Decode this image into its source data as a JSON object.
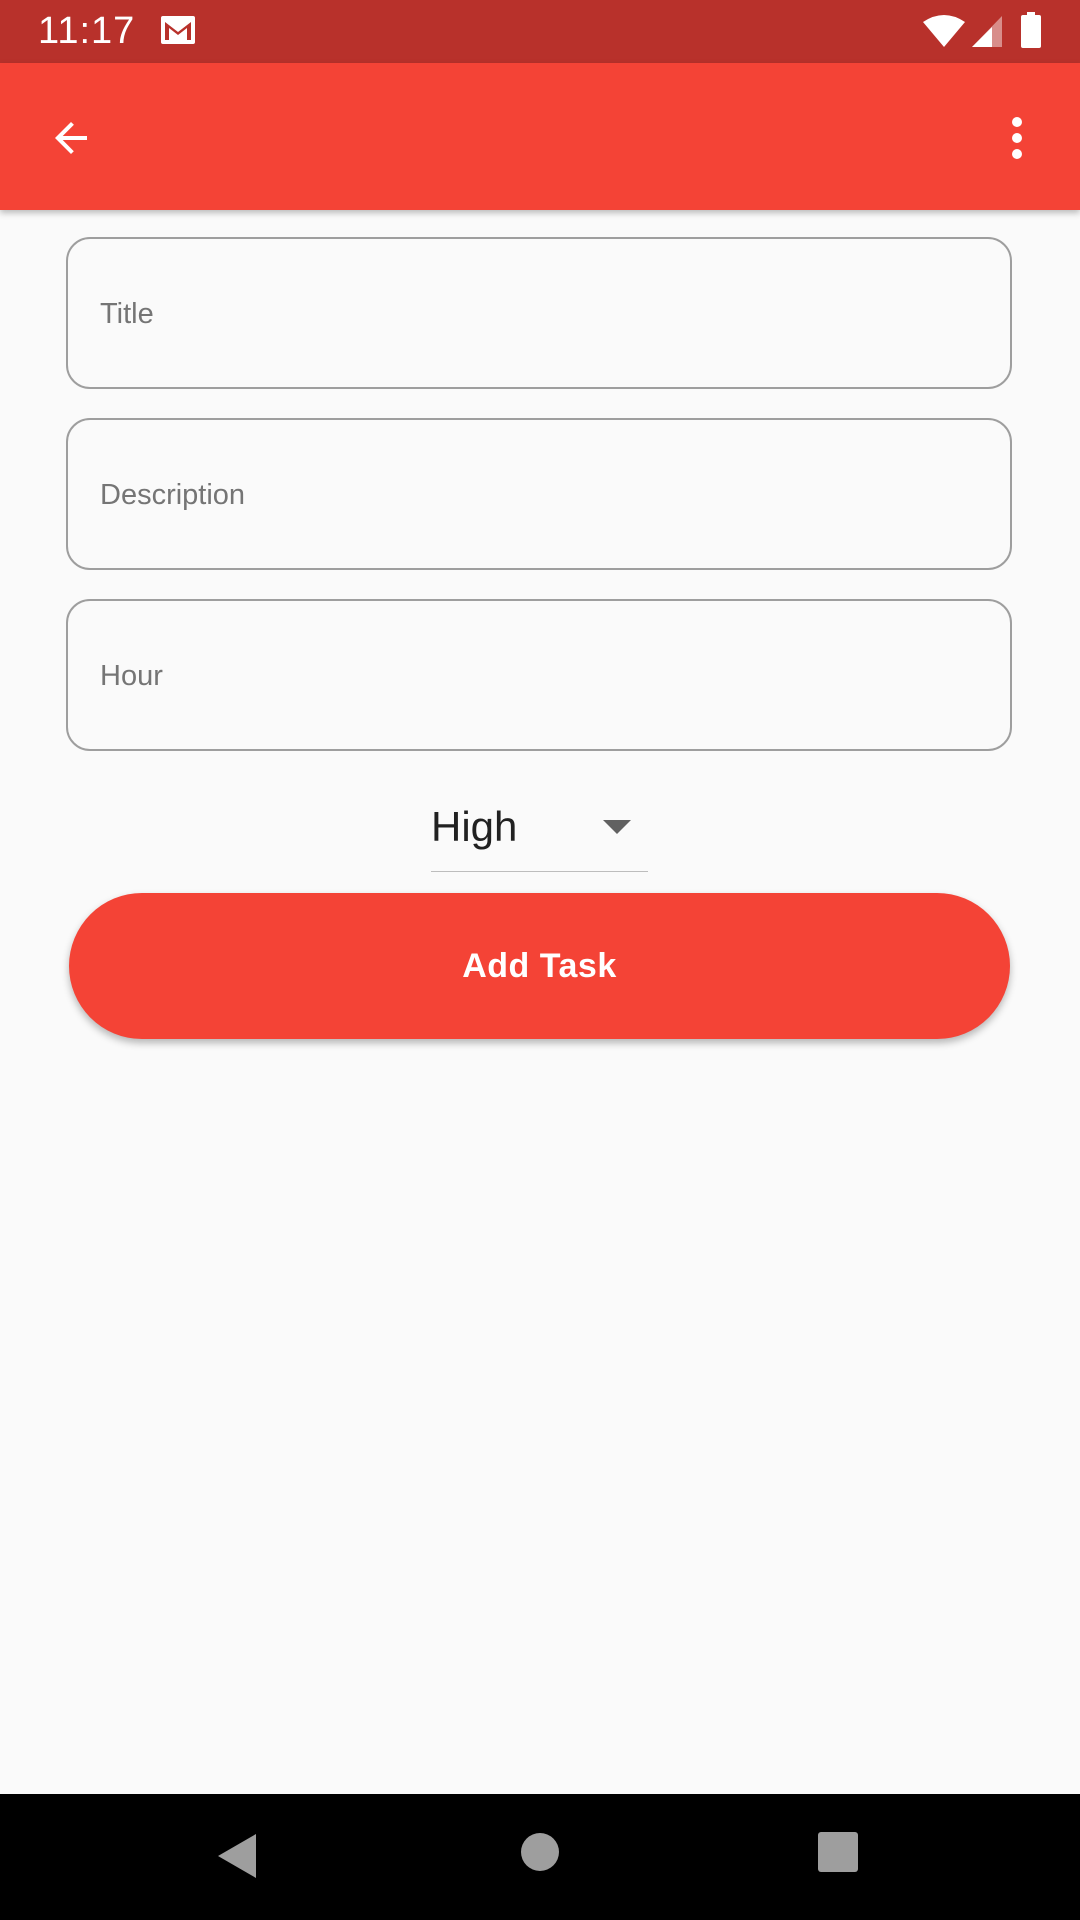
{
  "status_bar": {
    "time": "11:17",
    "icons": [
      "gmail-icon",
      "wifi-icon",
      "signal-icon",
      "battery-icon"
    ]
  },
  "app_bar": {
    "color": "#f44336",
    "back_icon": "arrow-back-icon",
    "more_icon": "more-vert-icon"
  },
  "form": {
    "title_placeholder": "Title",
    "description_placeholder": "Description",
    "hour_placeholder": "Hour",
    "priority": {
      "selected": "High"
    },
    "submit_label": "Add Task"
  },
  "nav_bar": {
    "icons": [
      "nav-back-icon",
      "nav-home-icon",
      "nav-recents-icon"
    ]
  },
  "colors": {
    "accent": "#f44336",
    "status_bar": "#b8312b",
    "background": "#fafafa"
  }
}
